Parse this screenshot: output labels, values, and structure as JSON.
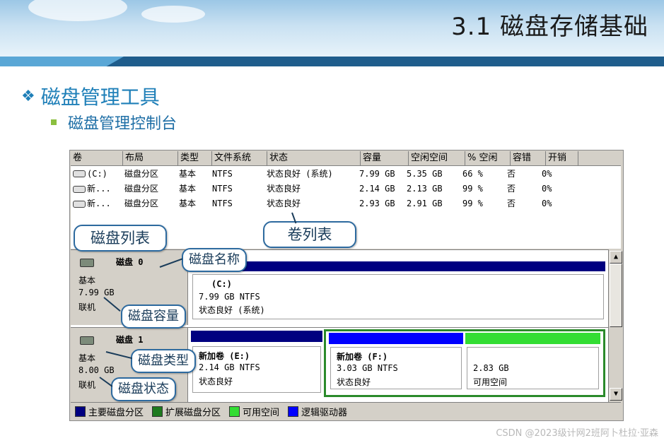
{
  "slide": {
    "title": "3.1  磁盘存储基础",
    "heading": "磁盘管理工具",
    "subheading": "磁盘管理控制台",
    "bullet_icon": "diamond-bullet-icon",
    "colors": {
      "heading": "#1e7fb8",
      "stripe": "#1f5d8c",
      "sub_bullet": "#8bbf3f"
    }
  },
  "volume_table": {
    "headers": [
      "卷",
      "布局",
      "类型",
      "文件系统",
      "状态",
      "容量",
      "空闲空间",
      "% 空闲",
      "容错",
      "开销"
    ],
    "rows": [
      [
        "(C:)",
        "磁盘分区",
        "基本",
        "NTFS",
        "状态良好 (系统)",
        "7.99 GB",
        "5.35 GB",
        "66 %",
        "否",
        "0%"
      ],
      [
        "新...",
        "磁盘分区",
        "基本",
        "NTFS",
        "状态良好",
        "2.14 GB",
        "2.13 GB",
        "99 %",
        "否",
        "0%"
      ],
      [
        "新...",
        "磁盘分区",
        "基本",
        "NTFS",
        "状态良好",
        "2.93 GB",
        "2.91 GB",
        "99 %",
        "否",
        "0%"
      ]
    ]
  },
  "disks": [
    {
      "name": "磁盘 0",
      "type": "基本",
      "size": "7.99 GB",
      "status": "联机",
      "partitions": [
        {
          "label": "(C:)",
          "fs": "7.99 GB NTFS",
          "status": "状态良好 (系统)",
          "color": "#000080"
        }
      ]
    },
    {
      "name": "磁盘 1",
      "type": "基本",
      "size": "8.00 GB",
      "status": "联机",
      "partitions": [
        {
          "label": "新加卷    (E:)",
          "fs": "2.14 GB NTFS",
          "status": "状态良好",
          "color": "#000080"
        },
        {
          "label": "新加卷    (F:)",
          "fs": "3.03 GB NTFS",
          "status": "状态良好",
          "color": "#0000ff"
        },
        {
          "label": "",
          "fs": "2.83 GB",
          "status": "可用空间",
          "color": "#33dd33"
        }
      ]
    }
  ],
  "legend": [
    {
      "label": "主要磁盘分区",
      "color": "#000080"
    },
    {
      "label": "扩展磁盘分区",
      "color": "#1e7a1e"
    },
    {
      "label": "可用空间",
      "color": "#33dd33"
    },
    {
      "label": "逻辑驱动器",
      "color": "#0000ff"
    }
  ],
  "callouts": {
    "disk_list": "磁盘列表",
    "volume_list": "卷列表",
    "disk_name": "磁盘名称",
    "disk_capacity": "磁盘容量",
    "disk_type": "磁盘类型",
    "disk_status": "磁盘状态"
  },
  "watermark": "CSDN @2023级计网2班阿卜杜拉·亚森"
}
